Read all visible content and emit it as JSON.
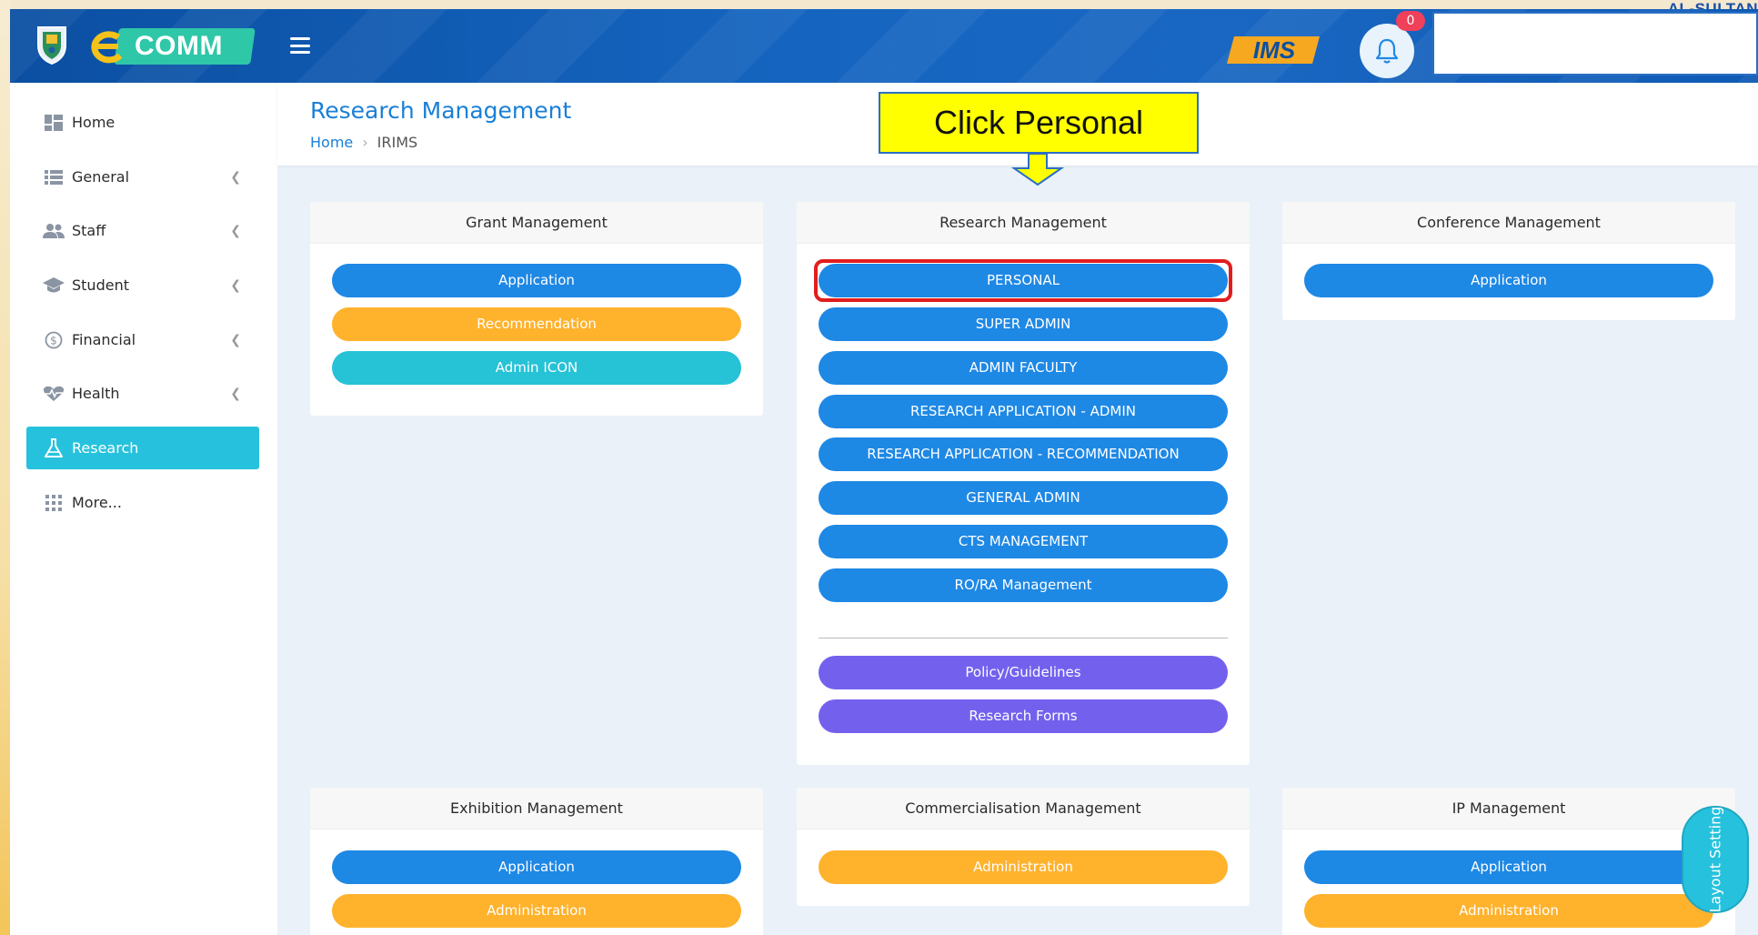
{
  "corner_brand": "AL-SULTAN",
  "header": {
    "brand_text": "COMM",
    "ims_text": "IMS",
    "notification_count": "0"
  },
  "sidebar": {
    "items": [
      {
        "label": "Home",
        "icon": "dashboard-icon",
        "has_chevron": false
      },
      {
        "label": "General",
        "icon": "list-icon",
        "has_chevron": true
      },
      {
        "label": "Staff",
        "icon": "users-icon",
        "has_chevron": true
      },
      {
        "label": "Student",
        "icon": "graduation-cap-icon",
        "has_chevron": true
      },
      {
        "label": "Financial",
        "icon": "dollar-icon",
        "has_chevron": true
      },
      {
        "label": "Health",
        "icon": "heartbeat-icon",
        "has_chevron": true
      },
      {
        "label": "Research",
        "icon": "flask-icon",
        "has_chevron": false,
        "active": true
      },
      {
        "label": "More...",
        "icon": "grid-icon",
        "has_chevron": false
      }
    ]
  },
  "page": {
    "title": "Research Management",
    "breadcrumb": {
      "home": "Home",
      "current": "IRIMS"
    }
  },
  "callout": {
    "text": "Click Personal"
  },
  "cards": {
    "grant": {
      "title": "Grant Management",
      "buttons": [
        "Application",
        "Recommendation",
        "Admin ICON"
      ]
    },
    "research": {
      "title": "Research Management",
      "buttons": [
        "PERSONAL",
        "SUPER ADMIN",
        "ADMIN FACULTY",
        "RESEARCH APPLICATION - ADMIN",
        "RESEARCH APPLICATION - RECOMMENDATION",
        "GENERAL ADMIN",
        "CTS MANAGEMENT",
        "RO/RA Management"
      ],
      "extra_buttons": [
        "Policy/Guidelines",
        "Research Forms"
      ]
    },
    "conference": {
      "title": "Conference Management",
      "buttons": [
        "Application"
      ]
    },
    "exhibition": {
      "title": "Exhibition Management",
      "buttons": [
        "Application",
        "Administration"
      ]
    },
    "commercialisation": {
      "title": "Commercialisation Management",
      "buttons": [
        "Administration"
      ]
    },
    "ip": {
      "title": "IP Management",
      "buttons": [
        "Application",
        "Administration"
      ]
    }
  },
  "layout_setting": "Layout Setting",
  "colors": {
    "primary": "#1e88e5",
    "accent": "#26c2dd",
    "warning": "#ffb22c",
    "purple": "#7361ee",
    "highlight": "#e21d1d",
    "callout": "#ffff00"
  }
}
